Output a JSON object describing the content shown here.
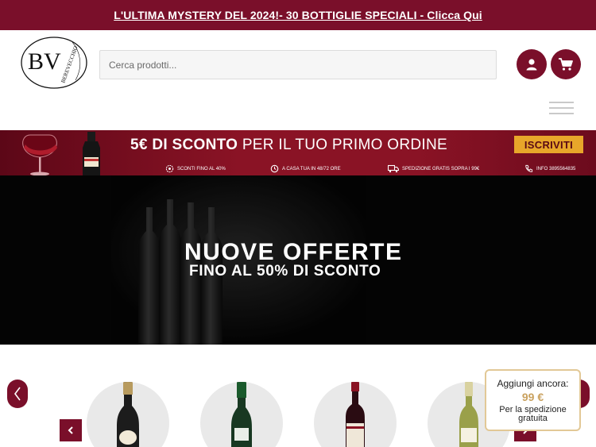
{
  "announcement": {
    "text": "L'ULTIMA MYSTERY DEL 2024!- 30 BOTTIGLIE SPECIALI - Clicca Qui"
  },
  "header": {
    "logo_initials": "BV",
    "logo_wordmark": "BEREVECCHIO",
    "search_placeholder": "Cerca prodotti...",
    "account_icon": "user-icon",
    "cart_icon": "cart-icon",
    "menu_icon": "hamburger-icon"
  },
  "promo": {
    "headline_bold": "5€ DI SCONTO",
    "headline_rest": "PER IL TUO PRIMO ORDINE",
    "cta_label": "ISCRIVITI",
    "features": [
      {
        "icon": "gear-badge-icon",
        "label": "SCONTI FINO AL 40%"
      },
      {
        "icon": "clock-icon",
        "label": "A CASA TUA IN 48/72 ORE"
      },
      {
        "icon": "truck-icon",
        "label": "SPEDIZIONE GRATIS SOPRA I 99€"
      },
      {
        "icon": "phone-icon",
        "label": "INFO 3895564835"
      }
    ]
  },
  "hero": {
    "title": "NUOVE OFFERTE",
    "subtitle": "FINO AL 50% DI SCONTO"
  },
  "shipping_notice": {
    "line1": "Aggiungi ancora:",
    "amount": "99 €",
    "line2": "Per la spedizione gratuita"
  },
  "colors": {
    "brand": "#7a0f2a",
    "accent_gold": "#e8a62a",
    "notice_border": "#e2c896"
  }
}
